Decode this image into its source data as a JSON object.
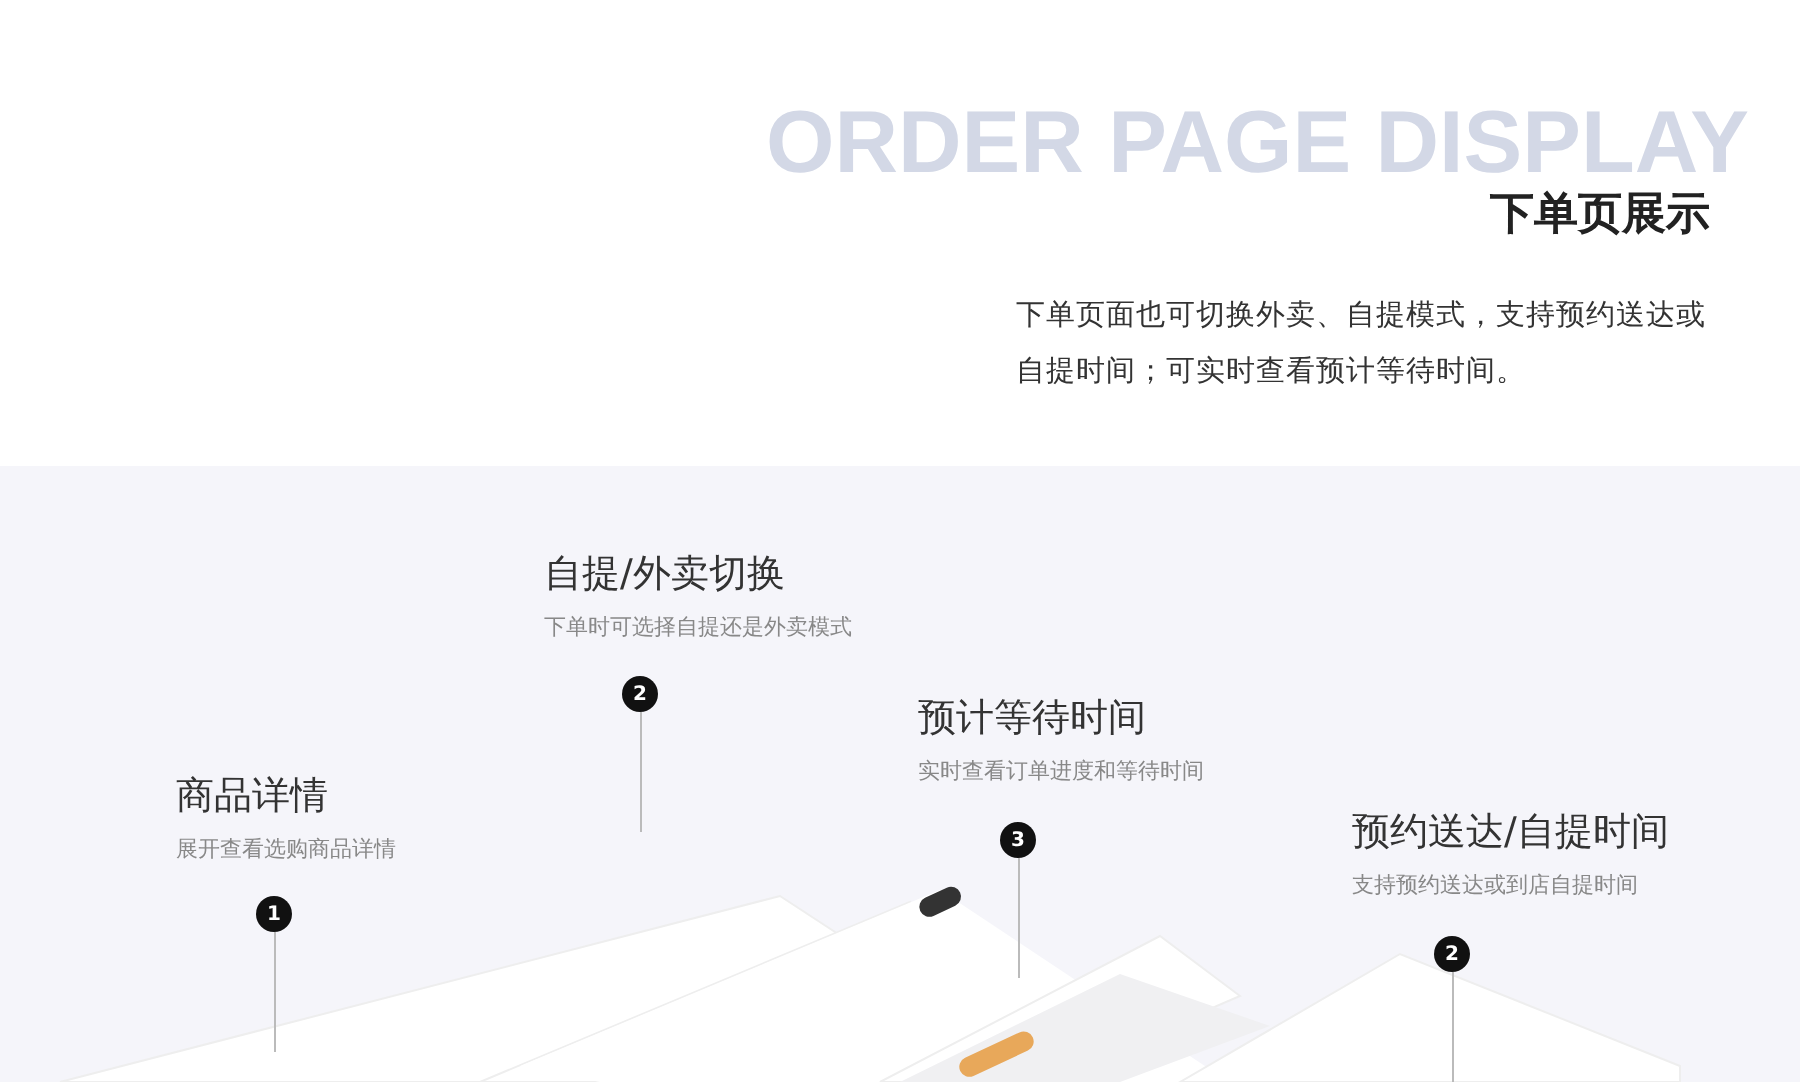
{
  "header": {
    "watermark": "ORDER PAGE DISPLAY",
    "title": "下单页展示",
    "description": "下单页面也可切换外卖、自提模式，支持预约送达或自提时间；可实时查看预计等待时间。"
  },
  "features": [
    {
      "title": "商品详情",
      "subtitle": "展开查看选购商品详情",
      "marker": "1"
    },
    {
      "title": "自提/外卖切换",
      "subtitle": "下单时可选择自提还是外卖模式",
      "marker": "2"
    },
    {
      "title": "预计等待时间",
      "subtitle": "实时查看订单进度和等待时间",
      "marker": "3"
    },
    {
      "title": "预约送达/自提时间",
      "subtitle": "支持预约送达或到店自提时间",
      "marker": "2"
    }
  ]
}
